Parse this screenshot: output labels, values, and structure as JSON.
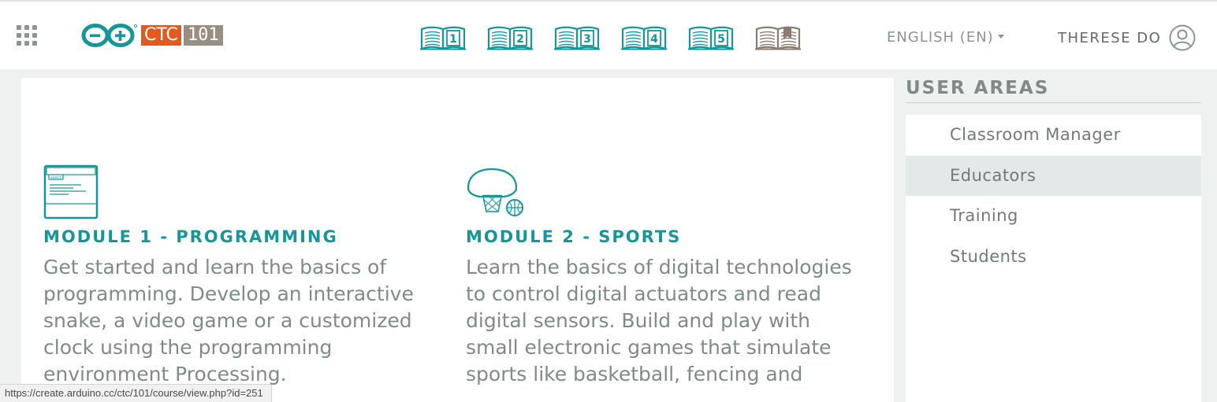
{
  "header": {
    "logo": {
      "ctc": "CTC",
      "num": "101"
    },
    "books": [
      {
        "label": "1",
        "color": "#16969a"
      },
      {
        "label": "2",
        "color": "#16969a"
      },
      {
        "label": "3",
        "color": "#16969a"
      },
      {
        "label": "4",
        "color": "#16969a"
      },
      {
        "label": "5",
        "color": "#16969a"
      },
      {
        "label": "",
        "color": "#8a7d70"
      }
    ],
    "language": "ENGLISH (EN)",
    "user_name": "THERESE DO"
  },
  "modules": [
    {
      "title": "MODULE 1 - PROGRAMMING",
      "description": "Get started and learn the basics of programming. Develop an interactive snake, a video game or a customized clock using the programming environment Processing.",
      "icon": "code-window-icon"
    },
    {
      "title": "MODULE 2 - SPORTS",
      "description": "Learn the basics of digital technologies to control digital actuators and read digital sensors. Build and play with small electronic games that simulate sports like basketball, fencing and",
      "icon": "basketball-hoop-icon"
    }
  ],
  "sidebar": {
    "title": "USER AREAS",
    "items": [
      {
        "label": "Classroom Manager"
      },
      {
        "label": "Educators",
        "active": true
      },
      {
        "label": "Training"
      },
      {
        "label": "Students"
      }
    ]
  },
  "status_url": "https://create.arduino.cc/ctc/101/course/view.php?id=251",
  "colors": {
    "teal": "#16969a",
    "orange": "#e35a1f",
    "taupe": "#9a8e82",
    "gray_text": "#7f8a89"
  }
}
